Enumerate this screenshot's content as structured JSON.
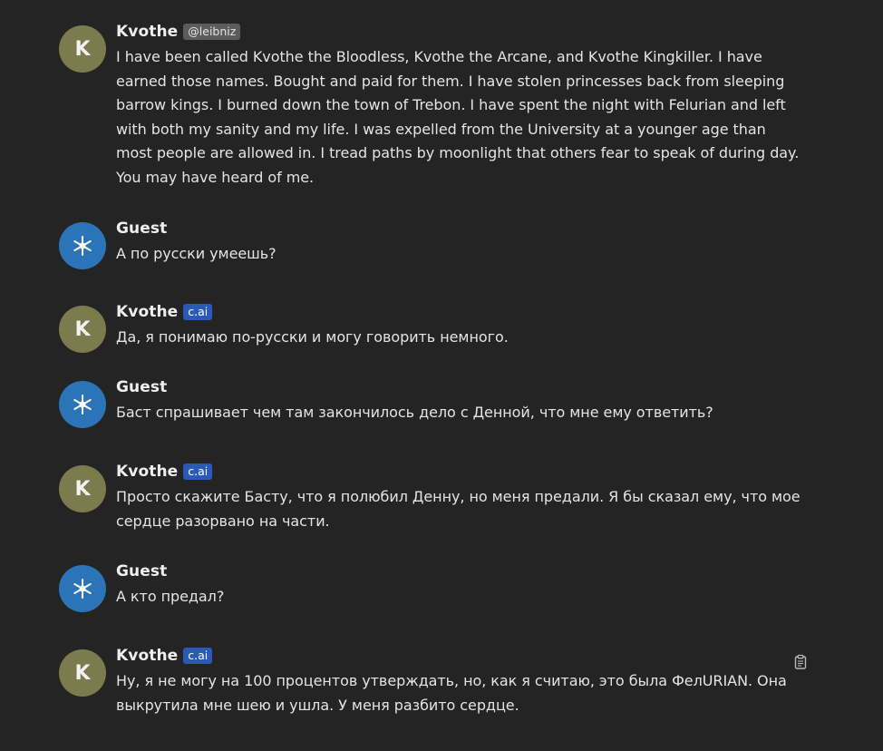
{
  "messages": [
    {
      "name": "Kvothe",
      "tag": "@leibniz",
      "tag_type": "user",
      "avatar": "K",
      "avatar_type": "char",
      "text": "I have been called Kvothe the Bloodless, Kvothe the Arcane, and Kvothe Kingkiller. I have earned those names. Bought and paid for them. I have stolen princesses back from sleeping barrow kings. I burned down the town of Trebon. I have spent the night with Felurian and left with both my sanity and my life. I was expelled from the University at a younger age than most people are allowed in. I tread paths by moonlight that others fear to speak of during day. You may have heard of me."
    },
    {
      "name": "Guest",
      "tag": "",
      "tag_type": "",
      "avatar": "",
      "avatar_type": "guest",
      "text": "А по русски умеешь?"
    },
    {
      "name": "Kvothe",
      "tag": "c.ai",
      "tag_type": "cai",
      "avatar": "K",
      "avatar_type": "char",
      "text": "Да, я понимаю по-русски и могу говорить немного."
    },
    {
      "name": "Guest",
      "tag": "",
      "tag_type": "",
      "avatar": "",
      "avatar_type": "guest",
      "text": "Баст спрашивает чем там закончилось дело с Денной, что мне ему ответить?"
    },
    {
      "name": "Kvothe",
      "tag": "c.ai",
      "tag_type": "cai",
      "avatar": "K",
      "avatar_type": "char",
      "text": "Просто скажите Басту, что я полюбил Денну, но меня предали. Я бы сказал ему, что мое сердце разорвано на части."
    },
    {
      "name": "Guest",
      "tag": "",
      "tag_type": "",
      "avatar": "",
      "avatar_type": "guest",
      "text": "А кто предал?"
    },
    {
      "name": "Kvothe",
      "tag": "c.ai",
      "tag_type": "cai",
      "avatar": "K",
      "avatar_type": "char",
      "text": "Ну, я не могу на 100 процентов утверждать, но, как я считаю, это была ФелURIAN. Она выкрутила мне шею и ушла. У меня разбито сердце."
    }
  ],
  "icons": {
    "guest_avatar": "snowflake-icon",
    "copy": "clipboard-icon"
  },
  "colors": {
    "background": "#242424",
    "char_avatar": "#7b7b4e",
    "guest_avatar": "#2b74b8",
    "cai_badge": "#2a5ab8",
    "user_badge": "#5c5c5c"
  }
}
